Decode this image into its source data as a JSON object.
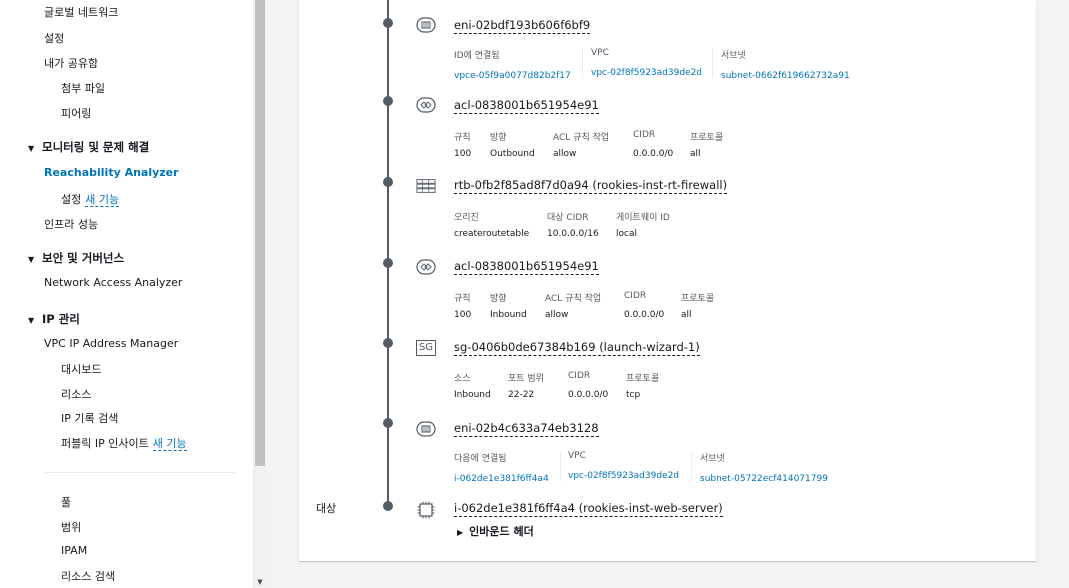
{
  "sidebar": {
    "items": {
      "global_network": "글로벌 네트워크",
      "settings": "설정",
      "shared_with_me": "내가 공유함",
      "attachments": "첨부 파일",
      "peering": "피어링",
      "section_monitoring": "모니터링 및 문제 해결",
      "reachability_analyzer": "Reachability Analyzer",
      "ra_settings": "설정",
      "new_feature": "새 기능",
      "infra_performance": "인프라 성능",
      "section_security": "보안 및 거버넌스",
      "network_access_analyzer": "Network Access Analyzer",
      "section_ip": "IP 관리",
      "vpc_ipam": "VPC IP Address Manager",
      "dashboard": "대시보드",
      "resources": "리소스",
      "ip_history": "IP 기록 검색",
      "public_ip_insights": "퍼블릭 IP 인사이트",
      "new_feature2": "새 기능",
      "pools": "풀",
      "scopes": "범위",
      "ipam": "IPAM",
      "resource_search": "리소스 검색"
    }
  },
  "path": {
    "target_label": "대상",
    "hops": [
      {
        "id": "eni-02bdf193b606f6bf9",
        "icon": "eni-icon",
        "fields": [
          {
            "label": "ID에 연결됨",
            "value": "vpce-05f9a0077d82b2f17"
          },
          {
            "label": "VPC",
            "value": "vpc-02f8f5923ad39de2d"
          },
          {
            "label": "서브넷",
            "value": "subnet-0662f619662732a91"
          }
        ]
      },
      {
        "id": "acl-0838001b651954e91",
        "icon": "nacl-icon",
        "headers": [
          "규칙",
          "방향",
          "ACL 규칙 작업",
          "CIDR",
          "프로토콜"
        ],
        "values": [
          "100",
          "Outbound",
          "allow",
          "0.0.0.0/0",
          "all"
        ]
      },
      {
        "id": "rtb-0fb2f85ad8f7d0a94 (rookies-inst-rt-firewall)",
        "icon": "route-table-icon",
        "headers": [
          "오리진",
          "대상 CIDR",
          "게이트웨이 ID"
        ],
        "values": [
          "createroutetable",
          "10.0.0.0/16",
          "local"
        ]
      },
      {
        "id": "acl-0838001b651954e91",
        "icon": "nacl-icon",
        "headers": [
          "규칙",
          "방향",
          "ACL 규칙 작업",
          "CIDR",
          "프로토콜"
        ],
        "values": [
          "100",
          "Inbound",
          "allow",
          "0.0.0.0/0",
          "all"
        ]
      },
      {
        "id": "sg-0406b0de67384b169 (launch-wizard-1)",
        "icon": "security-group-icon",
        "icon_text": "SG",
        "headers": [
          "소스",
          "포트 범위",
          "CIDR",
          "프로토콜"
        ],
        "values": [
          "Inbound",
          "22-22",
          "0.0.0.0/0",
          "tcp"
        ]
      },
      {
        "id": "eni-02b4c633a74eb3128",
        "icon": "eni-icon",
        "fields": [
          {
            "label": "다음에 연결됨",
            "value": "i-062de1e381f6ff4a4"
          },
          {
            "label": "VPC",
            "value": "vpc-02f8f5923ad39de2d"
          },
          {
            "label": "서브넷",
            "value": "subnet-05722ecf414071799"
          }
        ]
      },
      {
        "id": "i-062de1e381f6ff4a4 (rookies-inst-web-server)",
        "icon": "instance-icon"
      }
    ],
    "expand_label": "인바운드 헤더"
  },
  "colors": {
    "link": "#0073bb",
    "text": "#16191f",
    "muted": "#545b64"
  }
}
